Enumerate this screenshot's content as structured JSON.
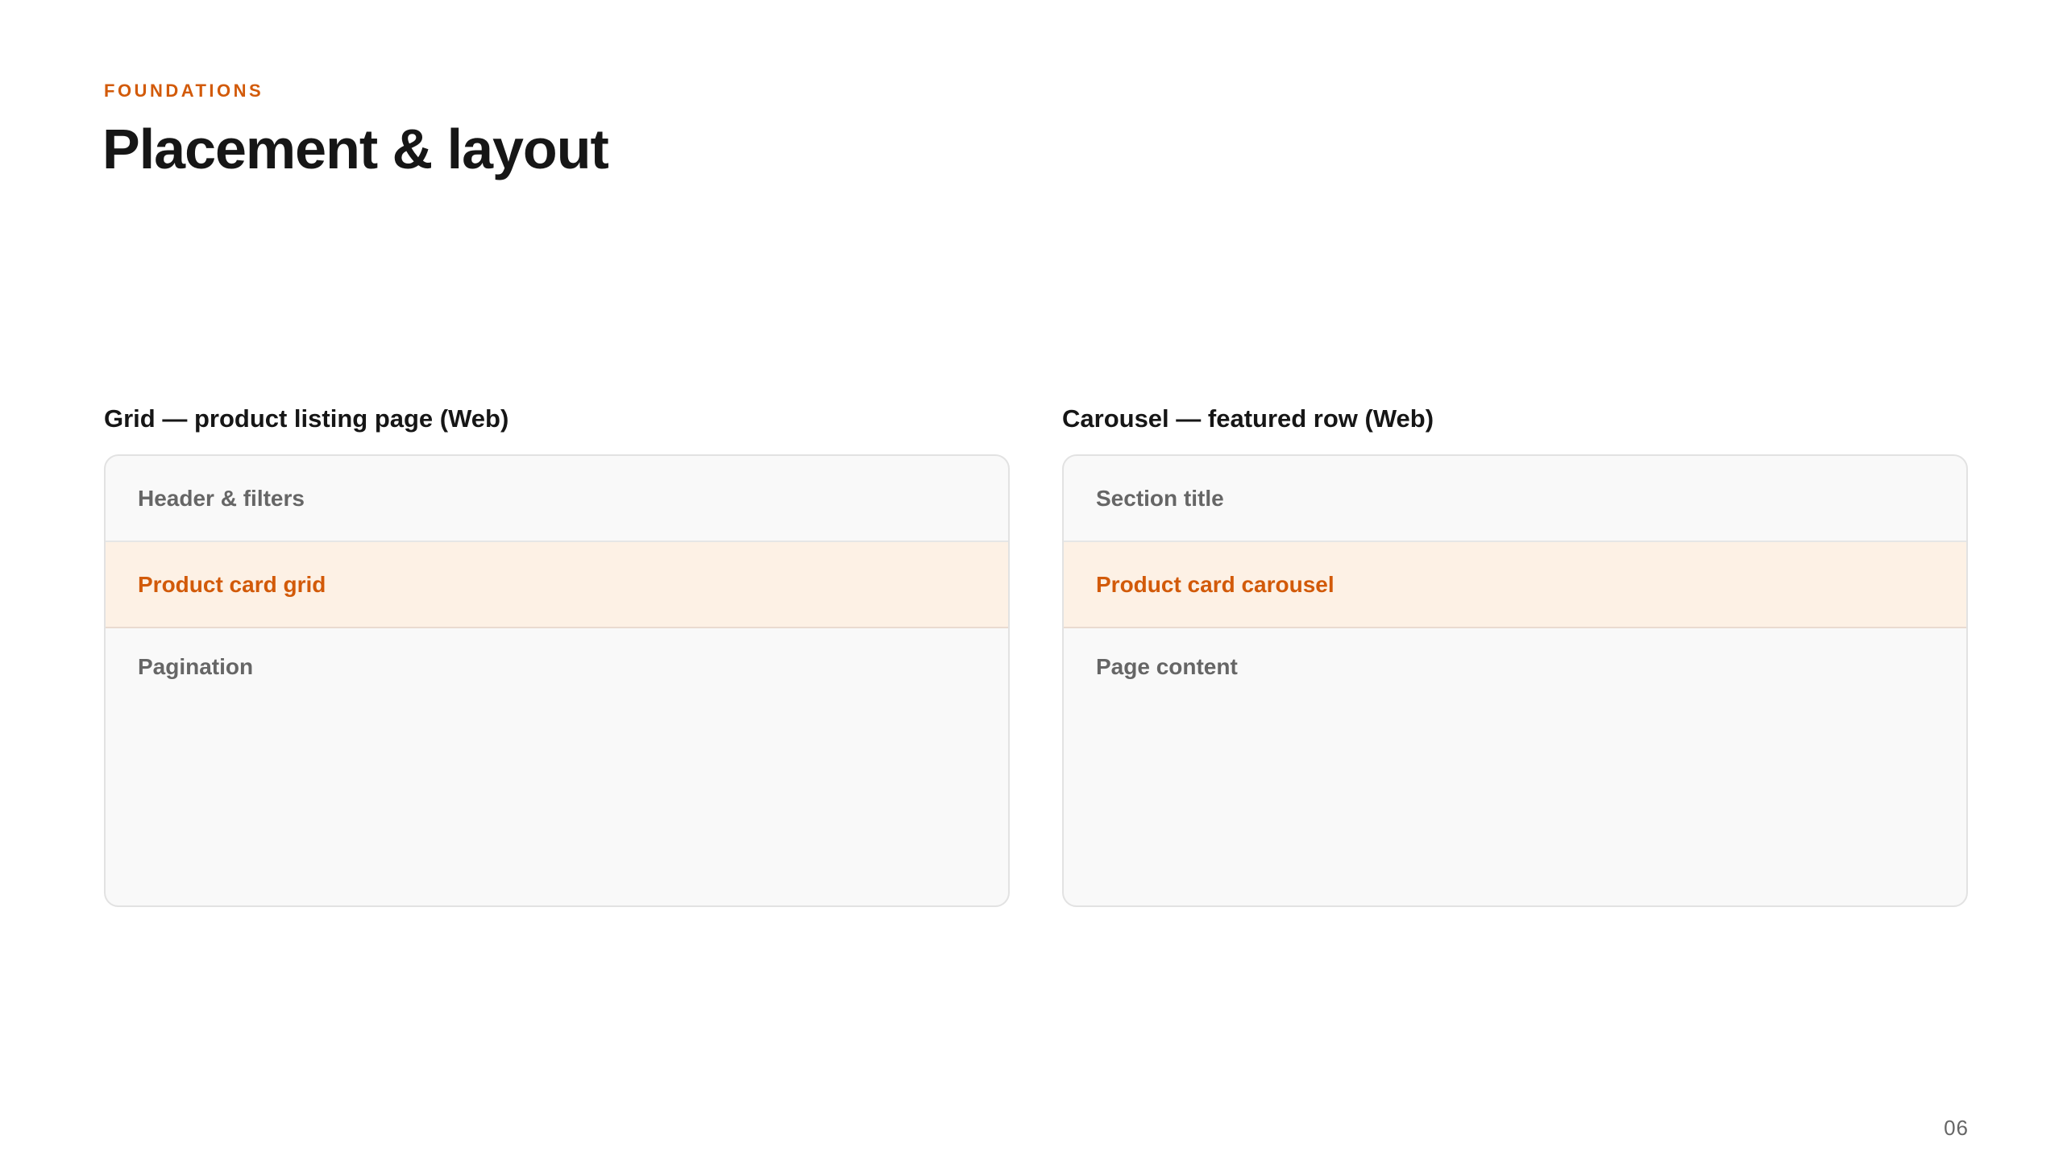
{
  "header": {
    "eyebrow": "FOUNDATIONS",
    "title": "Placement & layout"
  },
  "panels": [
    {
      "heading": "Grid — product listing page (Web)",
      "rows": [
        "Header & filters",
        "Product card grid",
        "Pagination"
      ],
      "highlighted_row": "Product card grid"
    },
    {
      "heading": "Carousel — featured row (Web)",
      "rows": [
        "Section title",
        "Product card carousel",
        "Page content"
      ],
      "highlighted_row": "Product card carousel"
    }
  ],
  "footer": {
    "page_number": "06"
  },
  "colors": {
    "accent": "#d25a09",
    "highlight_bg": "#fdf1e5",
    "card_bg": "#f9f9f9",
    "muted_text": "#666666",
    "text": "#161616"
  }
}
